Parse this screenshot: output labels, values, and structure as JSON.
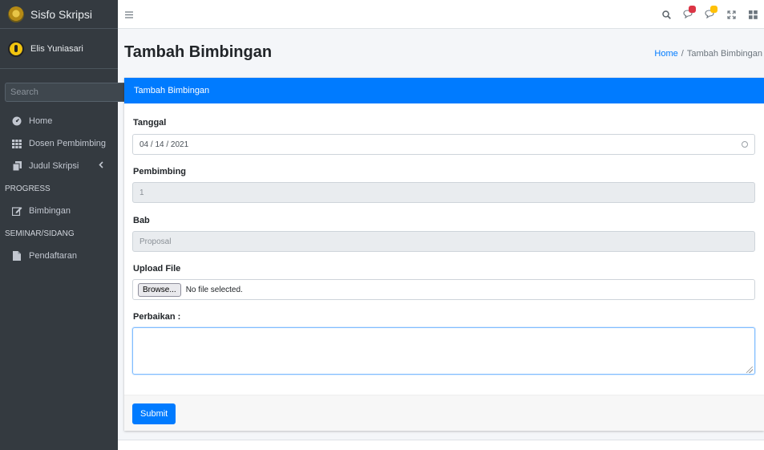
{
  "brand": {
    "name": "Sisfo Skripsi"
  },
  "user": {
    "name": "Elis Yuniasari"
  },
  "sidebar": {
    "search_placeholder": "Search",
    "items": [
      {
        "label": "Home",
        "icon": "tachometer-icon"
      },
      {
        "label": "Dosen Pembimbing",
        "icon": "th-icon"
      },
      {
        "label": "Judul Skripsi",
        "icon": "copy-icon"
      },
      {
        "header": "PROGRESS"
      },
      {
        "label": "Bimbingan",
        "icon": "edit-icon"
      },
      {
        "header": "SEMINAR/SIDANG"
      },
      {
        "label": "Pendaftaran",
        "icon": "file-icon"
      }
    ]
  },
  "topbar": {
    "icons": [
      "search-icon",
      "comments-icon",
      "bell-icon",
      "expand-icon",
      "grid-icon"
    ]
  },
  "page": {
    "title": "Tambah Bimbingan",
    "breadcrumb_home": "Home",
    "breadcrumb_sep": "/",
    "breadcrumb_current": "Tambah Bimbingan"
  },
  "form": {
    "header": "Tambah Bimbingan",
    "tanggal_label": "Tanggal",
    "tanggal_value": "04 / 14 / 2021",
    "pembimbing_label": "Pembimbing",
    "pembimbing_value": "1",
    "bab_label": "Bab",
    "bab_value": "Proposal",
    "upload_label": "Upload File",
    "browse_label": "Browse...",
    "file_status": "No file selected.",
    "perbaikan_label": "Perbaikan :",
    "perbaikan_value": "",
    "submit_label": "Submit"
  },
  "colors": {
    "primary": "#007bff",
    "sidebar": "#343a40",
    "danger": "#dc3545",
    "warning": "#ffc107"
  }
}
